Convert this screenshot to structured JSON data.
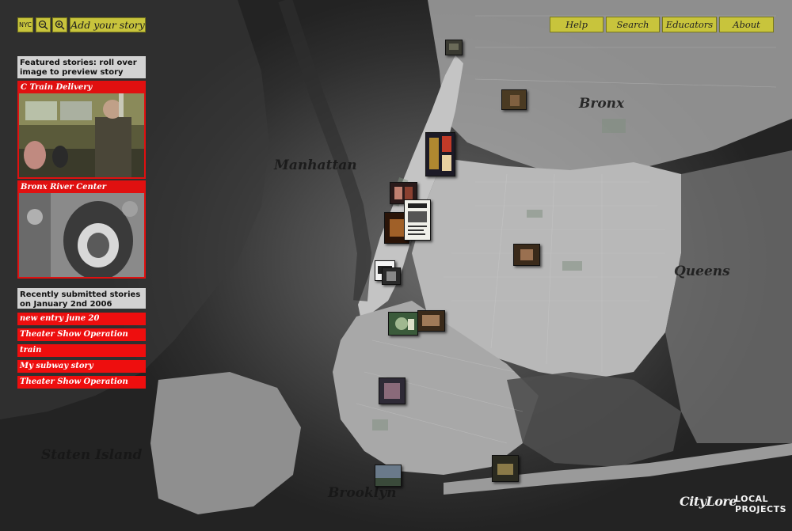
{
  "toolbar": {
    "nyc_label": "NYC",
    "add_story_label": "Add your story"
  },
  "nav": {
    "help": "Help",
    "search": "Search",
    "educators": "Educators",
    "about": "About"
  },
  "featured": {
    "heading": "Featured stories: roll over image to preview story",
    "stories": [
      {
        "title": "C Train Delivery"
      },
      {
        "title": "Bronx River Center"
      }
    ]
  },
  "recent": {
    "heading": "Recently submitted stories on January 2nd 2006",
    "items": [
      {
        "title": "new entry june 20"
      },
      {
        "title": "Theater Show Operation"
      },
      {
        "title": "train"
      },
      {
        "title": "My subway story"
      },
      {
        "title": "Theater Show Operation"
      }
    ]
  },
  "boroughs": {
    "bronx": "Bronx",
    "manhattan": "Manhattan",
    "queens": "Queens",
    "staten_island": "Staten Island",
    "brooklyn": "Brooklyn"
  },
  "logo": {
    "city": "CityLore",
    "local": "LOCAL",
    "projects": "PROJECTS"
  },
  "colors": {
    "accent_yellow": "#c8c43c",
    "accent_red": "#e01010",
    "panel_gray": "#d2d2d2"
  }
}
